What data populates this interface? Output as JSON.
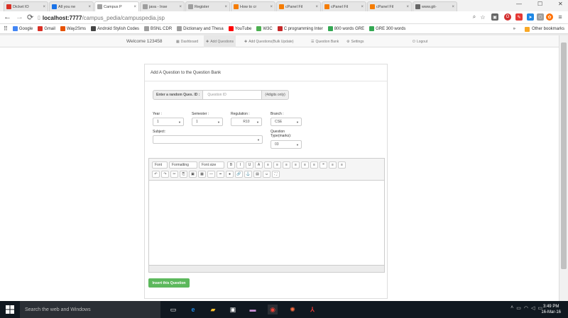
{
  "browser": {
    "tabs": [
      {
        "title": "Dicket IO",
        "icon": "gmail-icon",
        "color": "#d93025"
      },
      {
        "title": "All you ne",
        "icon": "globe-icon",
        "color": "#1a73e8"
      },
      {
        "title": "Campus P",
        "icon": "page-icon",
        "color": "#9e9e9e",
        "active": true
      },
      {
        "title": "java - Inse",
        "icon": "page-icon",
        "color": "#9e9e9e"
      },
      {
        "title": "Register",
        "icon": "page-icon",
        "color": "#9e9e9e"
      },
      {
        "title": "How to cr",
        "icon": "orange-icon",
        "color": "#f57c00"
      },
      {
        "title": "cPanel Fil",
        "icon": "cpanel-icon",
        "color": "#f57c00"
      },
      {
        "title": "cPanel Fil",
        "icon": "cpanel-icon",
        "color": "#f57c00"
      },
      {
        "title": "cPanel Fil",
        "icon": "cpanel-icon",
        "color": "#f57c00"
      },
      {
        "title": "www.git-",
        "icon": "git-icon",
        "color": "#666666"
      }
    ],
    "url_host": "localhost:7777",
    "url_path": "/campus_pedia/campuspedia.jsp",
    "bookmarks": [
      {
        "label": "Google",
        "icon": "google-icon",
        "color": "#4285f4"
      },
      {
        "label": "Gmail",
        "icon": "gmail-icon",
        "color": "#d93025"
      },
      {
        "label": "Way2Sms",
        "icon": "way2sms-icon",
        "color": "#e65100"
      },
      {
        "label": "Android Stylish Codes",
        "icon": "android-icon",
        "color": "#444444"
      },
      {
        "label": "BSNL CDR",
        "icon": "page-icon",
        "color": "#9e9e9e"
      },
      {
        "label": "Dictionary and Thesa",
        "icon": "dictionary-icon",
        "color": "#9e9e9e"
      },
      {
        "label": "YouTube",
        "icon": "youtube-icon",
        "color": "#ff0000"
      },
      {
        "label": "W3C",
        "icon": "w3c-icon",
        "color": "#4caf50"
      },
      {
        "label": "C programming Inter",
        "icon": "c-icon",
        "color": "#c62828"
      },
      {
        "label": "800 words GRE",
        "icon": "sheet-icon",
        "color": "#34a853"
      },
      {
        "label": "GRE 300 words",
        "icon": "sheet-icon",
        "color": "#34a853"
      }
    ],
    "other_bookmarks": "Other bookmarks"
  },
  "app_nav": {
    "welcome": "Welcome 123458",
    "items": [
      {
        "label": "Dashboard",
        "icon": "dashboard-icon"
      },
      {
        "label": "Add Questions",
        "icon": "plus-icon",
        "active": true
      },
      {
        "label": "Add Questions(Bulk Update)",
        "icon": "plus-icon"
      },
      {
        "label": "Question Bank",
        "icon": "list-icon"
      },
      {
        "label": "Settings",
        "icon": "gear-icon"
      },
      {
        "label": "Logout",
        "icon": "power-icon"
      }
    ]
  },
  "form": {
    "title": "Add A Question to the Question Bank",
    "qid_label": "Enter a random Ques. ID :",
    "qid_placeholder": "Question ID",
    "qid_hint": "(4digits only)",
    "year_label": "Year :",
    "year_value": "1",
    "semester_label": "Semester :",
    "semester_value": "1",
    "regulation_label": "Regulation :",
    "regulation_value": "R10",
    "branch_label": "Branch :",
    "branch_value": "CSE",
    "subject_label": "Subject:",
    "subject_value": "",
    "qtype_label": "Question Type(marks):",
    "qtype_value": "03",
    "submit_label": "Insert this Question"
  },
  "editor": {
    "dropdowns": [
      "Font",
      "Formatting",
      "Font size"
    ],
    "row1_buttons": [
      "B",
      "I",
      "U",
      "A",
      "≡",
      "≡",
      "≡",
      "≡",
      "≡",
      "≡",
      "❝",
      "≡",
      "≡"
    ],
    "row2_buttons": [
      "↶",
      "↷",
      "✂",
      "⎘",
      "▣",
      "▦",
      "—",
      "━",
      "●",
      "🔗",
      "⚓",
      "▤",
      "☺",
      "⛶"
    ]
  },
  "taskbar": {
    "search_placeholder": "Search the web and Windows",
    "time": "3:49 PM",
    "date": "16-Mar-16",
    "icons": [
      "task-view-icon",
      "edge-icon",
      "file-explorer-icon",
      "store-icon",
      "app-icon",
      "chrome-icon",
      "app-icon",
      "acrobat-icon"
    ]
  },
  "colors": {
    "submit": "#5cb85c",
    "taskbar": "#101820"
  }
}
